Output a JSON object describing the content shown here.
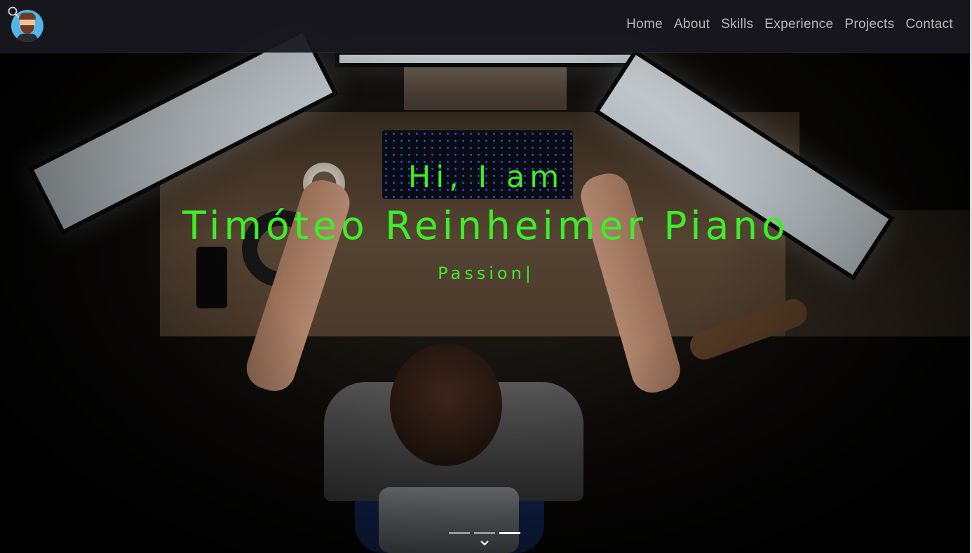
{
  "nav": {
    "logo_alt": "avatar",
    "links": [
      {
        "label": "Home"
      },
      {
        "label": "About"
      },
      {
        "label": "Skills"
      },
      {
        "label": "Experience"
      },
      {
        "label": "Projects"
      },
      {
        "label": "Contact"
      }
    ]
  },
  "hero": {
    "greeting": "Hi, I am",
    "name": "Timóteo Reinheimer Piano",
    "typed_text": "Passion",
    "cursor": "|",
    "accent_color": "#3ded2a",
    "slide_indicators": 3,
    "active_slide": 3
  },
  "icons": {
    "search": "search-icon",
    "scroll": "chevron-down-icon"
  }
}
